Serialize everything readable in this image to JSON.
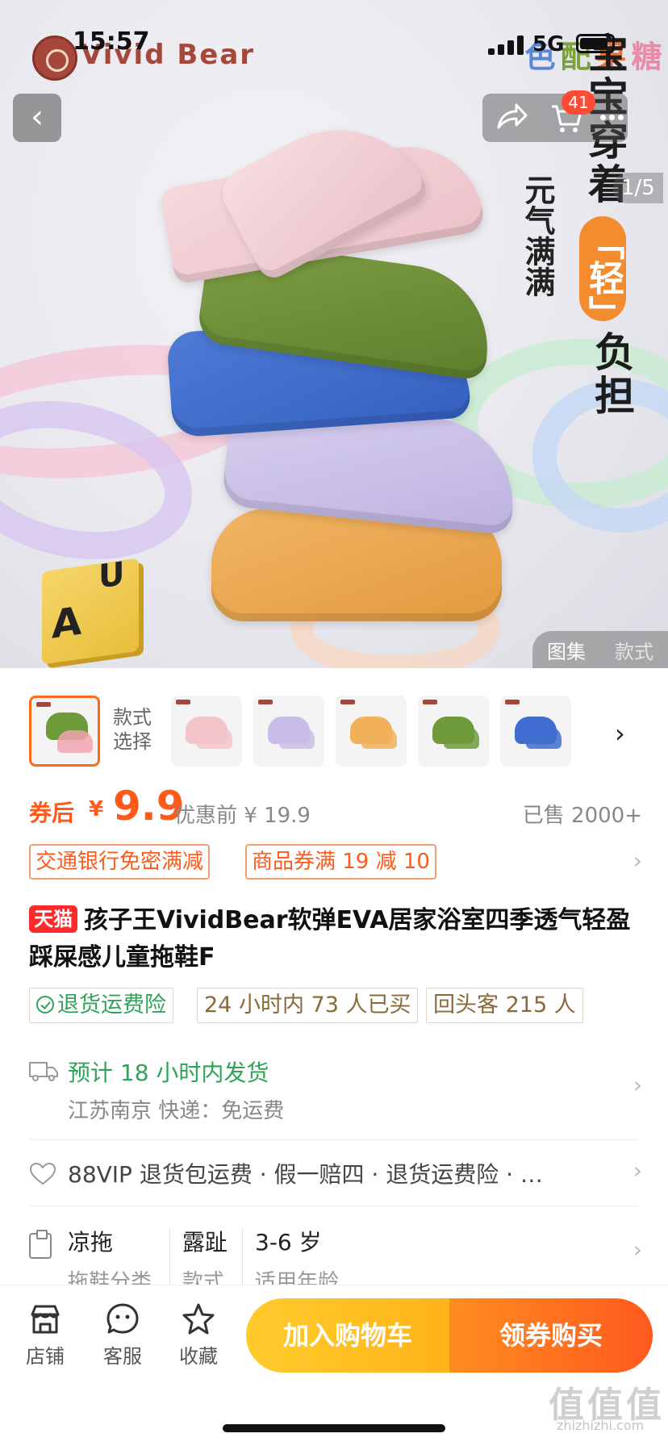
{
  "status_bar": {
    "time": "15:57",
    "network": "5G"
  },
  "hero": {
    "brand": "Vivid Bear",
    "headline_vertical": "宝宝穿着",
    "headline_badge": "「轻」",
    "headline_vertical2": "负担",
    "colorful_chars": [
      "糖",
      "果",
      "配",
      "色"
    ],
    "colorful_colors": [
      "#e88aa8",
      "#e8743a",
      "#7aa23a",
      "#5a86d8"
    ],
    "subline_vertical": "元气满满",
    "cube_letters": [
      "A",
      "U"
    ],
    "cart_count": "41",
    "image_counter": "1/5",
    "gallery_tabs": [
      "图集",
      "款式"
    ]
  },
  "style_selector": {
    "label_line1": "款式",
    "label_line2": "选择",
    "thumb_colors": [
      "#f0a3b0",
      "#f3c4cb",
      "#c8bde8",
      "#f0b15a",
      "#6e9a3a",
      "#3f6ccf"
    ]
  },
  "price": {
    "coupon_label": "券后",
    "currency": "¥",
    "value": "9.9",
    "before": "优惠前 ¥ 19.9",
    "sold": "已售 2000+"
  },
  "promos": [
    "交通银行免密满减",
    "商品券满 19 减 10"
  ],
  "product": {
    "platform_badge": "天猫",
    "title": "孩子王VividBear软弹EVA居家浴室四季透气轻盈踩屎感儿童拖鞋F"
  },
  "tags": [
    "退货运费险",
    "24 小时内 73 人已买",
    "回头客 215 人"
  ],
  "shipping": {
    "main": "预计 18 小时内发货",
    "sub": "江苏南京  快递：免运费"
  },
  "services": "88VIP 退货包运费 · 假一赔四 · 退货运费险 · …",
  "attributes": [
    {
      "value": "凉拖",
      "key": "拖鞋分类"
    },
    {
      "value": "露趾",
      "key": "款式"
    },
    {
      "value": "3-6 岁",
      "key": "适用年龄"
    }
  ],
  "bottom_bar": {
    "store": "店铺",
    "service": "客服",
    "favorite": "收藏",
    "add_to_cart": "加入购物车",
    "buy": "领券购买"
  },
  "watermark": {
    "main": "值值值",
    "sub": "zhizhizhi.com"
  }
}
